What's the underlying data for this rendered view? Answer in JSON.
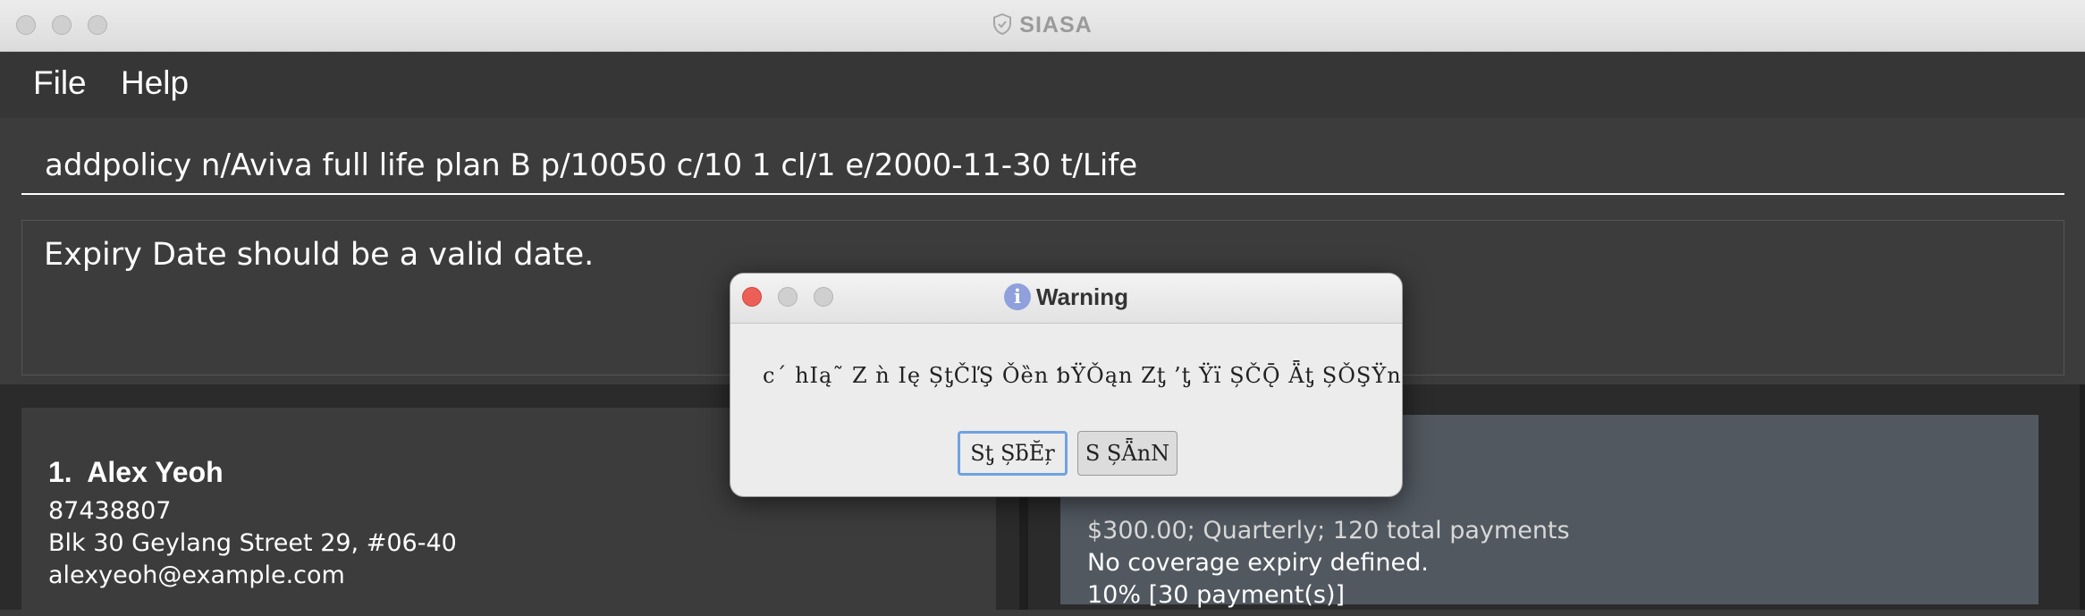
{
  "window": {
    "title": "SIASA",
    "title_icon": "shield-icon"
  },
  "menu": {
    "items": [
      "File",
      "Help"
    ]
  },
  "command": {
    "value": "addpolicy n/Aviva full life plan B p/10050 c/10 1 cl/1 e/2000-11-30 t/Life"
  },
  "result": {
    "text": "Expiry Date should be a valid date."
  },
  "person_list": {
    "persons": [
      {
        "index": "1.",
        "name": "Alex Yeoh",
        "phone": "87438807",
        "address": "Blk 30 Geylang Street 29, #06-40",
        "email": "alexyeoh@example.com"
      }
    ]
  },
  "policy_list": {
    "policies": [
      {
        "payment": "$300.00; Quarterly; 120 total payments",
        "coverage": "No coverage expiry defined.",
        "commission": "10% [30 payment(s)]"
      }
    ]
  },
  "dialog": {
    "title": "Warning",
    "icon": "info-icon",
    "message": "c´ hIą˜ Z  ǹ Ię ȘƫČľŞ Ǒȅn ƅŸǑąn Zƫ  ’ƫ Ÿï   ȘČǬ Ǟƫ ȘǑŞŸnť",
    "primary_button": "Sƫ ȘƃĔŗ",
    "secondary_button": "S  ȘǞnN"
  },
  "colors": {
    "background": "#3c3c3c",
    "panel_dark": "#2b2b2b",
    "policy_card": "#515860",
    "accent": "#6fa2e0",
    "close_red": "#ec5f57",
    "text": "#ffffff"
  }
}
